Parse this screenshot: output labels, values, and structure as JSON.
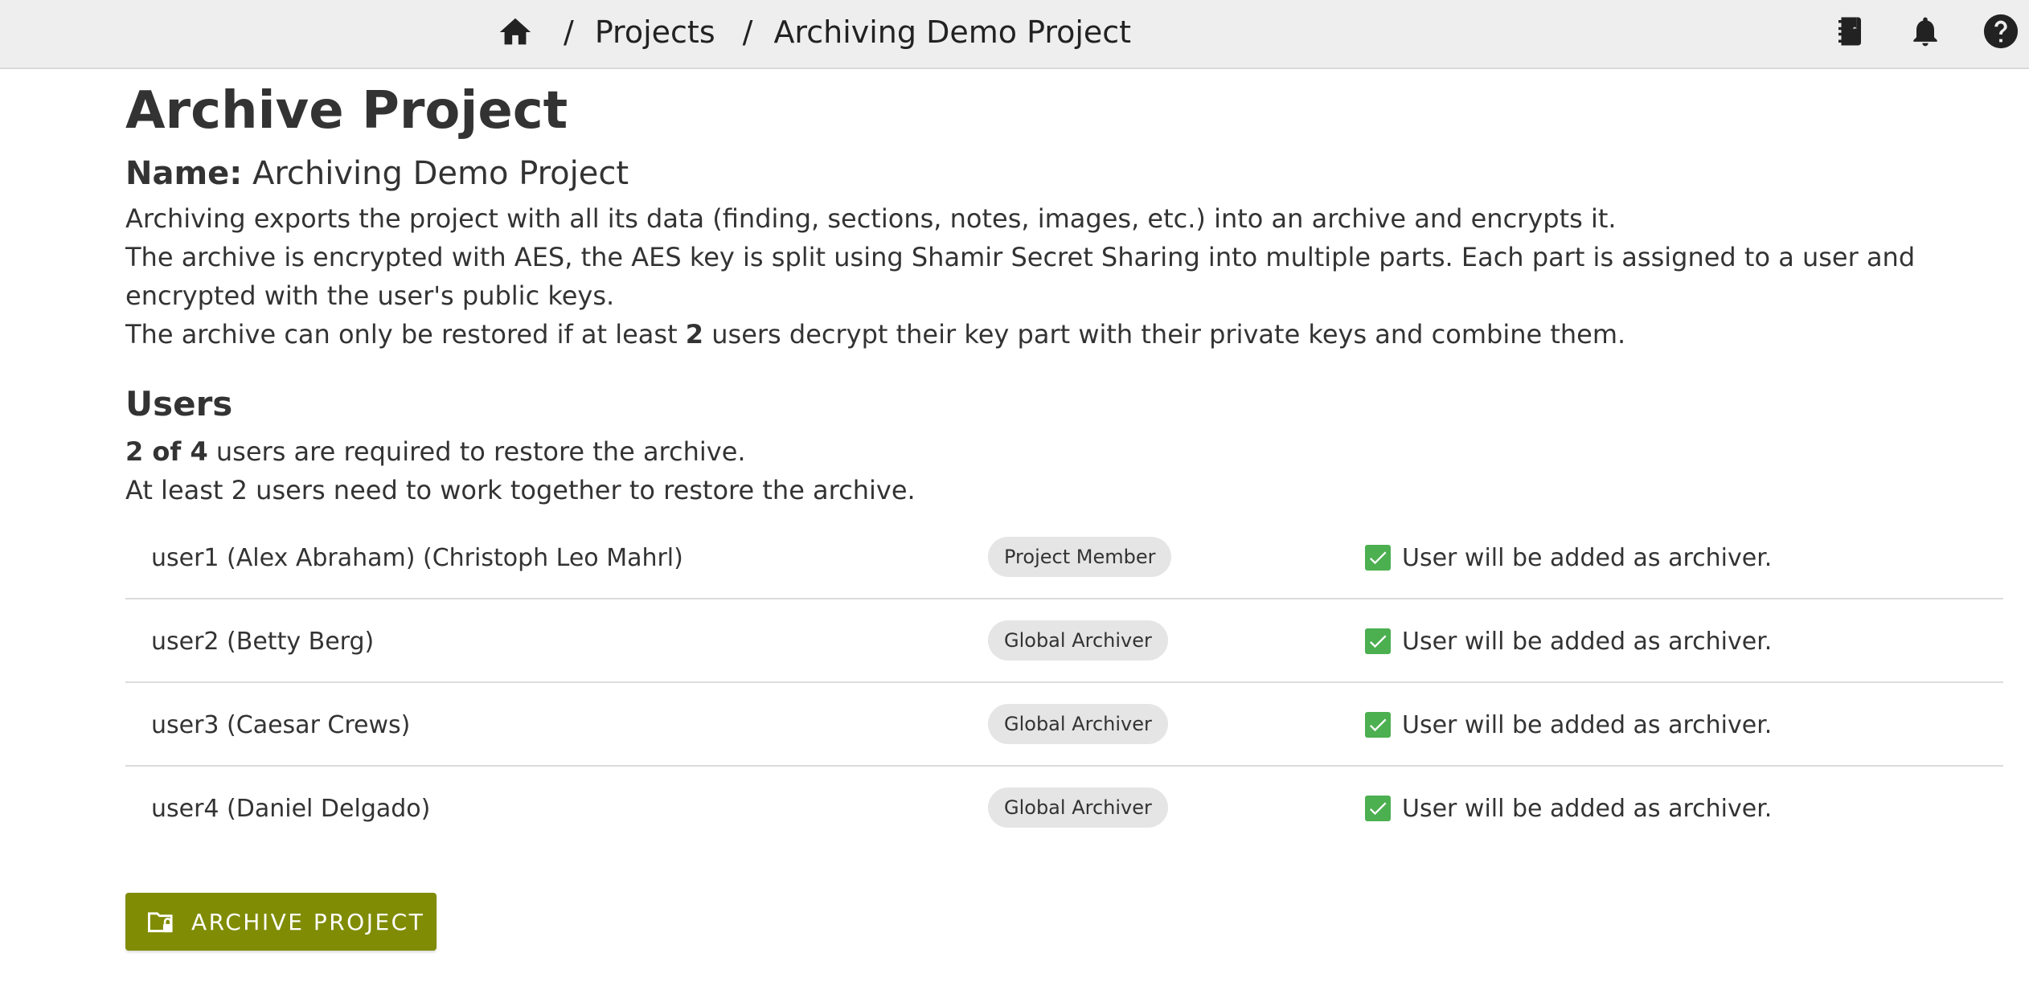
{
  "breadcrumb": {
    "separator": "/",
    "items": [
      {
        "label": "Projects"
      },
      {
        "label": "Archiving Demo Project"
      }
    ]
  },
  "top_icons": [
    "notebook-icon",
    "bell-icon",
    "help-icon"
  ],
  "page": {
    "title": "Archive Project",
    "name_label": "Name:",
    "name_value": "Archiving Demo Project",
    "description": {
      "line1": "Archiving exports the project with all its data (finding, sections, notes, images, etc.) into an archive and encrypts it.",
      "line2": "The archive is encrypted with AES, the AES key is split using Shamir Secret Sharing into multiple parts. Each part is assigned to a user and encrypted with the user's public keys.",
      "line3_prefix": "The archive can only be restored if at least ",
      "line3_count": "2",
      "line3_suffix": " users decrypt their key part with their private keys and combine them."
    }
  },
  "users": {
    "heading": "Users",
    "required_count": "2 of 4",
    "required_suffix": " users are required to restore the archive.",
    "need_text": "At least 2 users need to work together to restore the archive.",
    "rows": [
      {
        "name": "user1 (Alex Abraham) (Christoph Leo Mahrl)",
        "role": "Project Member",
        "status": "User will be added as archiver."
      },
      {
        "name": "user2 (Betty Berg)",
        "role": "Global Archiver",
        "status": "User will be added as archiver."
      },
      {
        "name": "user3 (Caesar Crews)",
        "role": "Global Archiver",
        "status": "User will be added as archiver."
      },
      {
        "name": "user4 (Daniel Delgado)",
        "role": "Global Archiver",
        "status": "User will be added as archiver."
      }
    ]
  },
  "actions": {
    "archive_label": "ARCHIVE PROJECT"
  },
  "colors": {
    "topbar_bg": "#eeeeee",
    "primary_button": "#808c04",
    "check_green": "#4caf50",
    "chip_bg": "#e5e5e5"
  }
}
